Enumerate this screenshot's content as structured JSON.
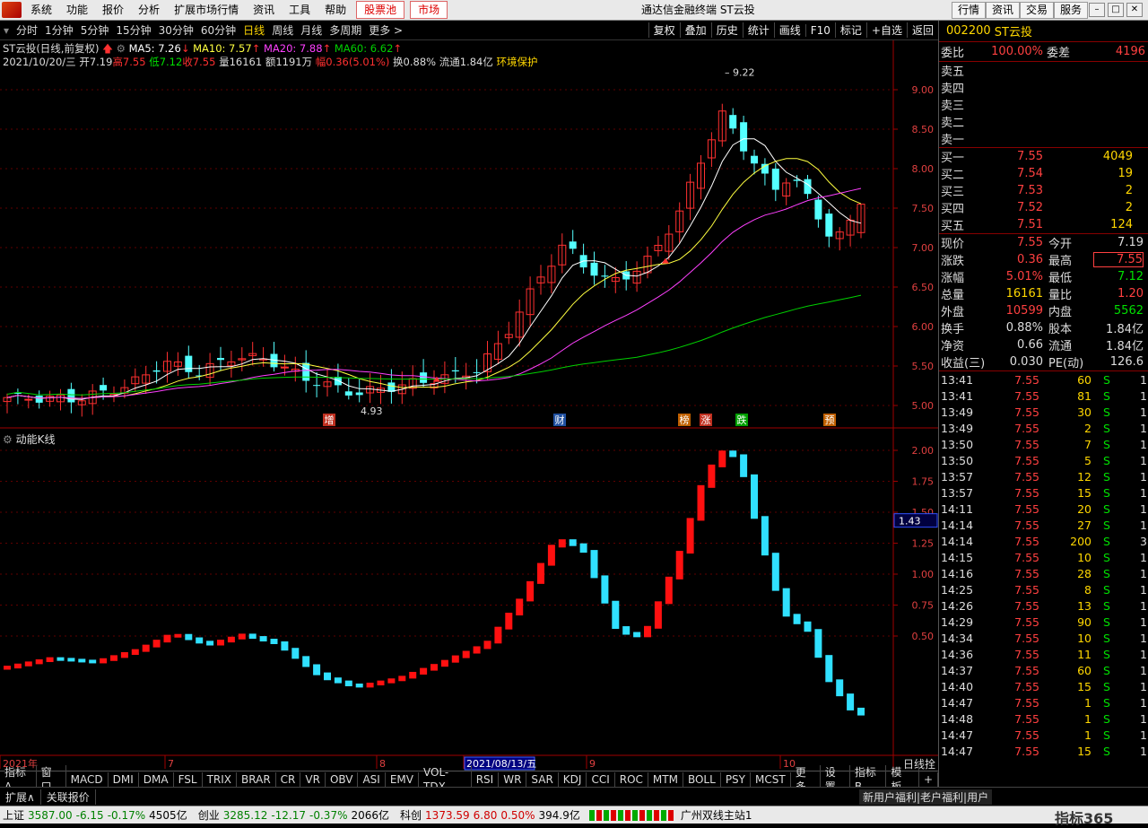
{
  "menubar": {
    "items": [
      "系统",
      "功能",
      "报价",
      "分析",
      "扩展市场行情",
      "资讯",
      "工具",
      "帮助"
    ],
    "red_items": [
      "股票池",
      "市场"
    ],
    "title": "通达信金融终端  ST云投",
    "right_buttons": [
      "行情",
      "资讯",
      "交易",
      "服务"
    ]
  },
  "periods": {
    "items": [
      "分时",
      "1分钟",
      "5分钟",
      "15分钟",
      "30分钟",
      "60分钟",
      "日线",
      "周线",
      "月线",
      "多周期",
      "更多 >"
    ],
    "selected": "日线"
  },
  "tools": [
    "复权",
    "叠加",
    "历史",
    "统计",
    "画线",
    "F10",
    "标记",
    "+自选",
    "返回"
  ],
  "chart": {
    "header": {
      "name": "ST云投(日线,前复权)",
      "ma5": "MA5: 7.26",
      "ma10": "MA10: 7.57",
      "ma20": "MA20: 7.88",
      "ma60": "MA60: 6.62"
    },
    "info": {
      "date": "2021/10/20/三",
      "open": "开7.19",
      "high": "高7.55",
      "low": "低7.12",
      "close": "收7.55",
      "vol": "量16161",
      "amt": "额1191万",
      "chg": "幅0.36(5.01%)",
      "turn": "换0.88%",
      "float": "流通1.84亿",
      "tag": "环境保护"
    },
    "price_ticks": [
      "9.00",
      "8.50",
      "8.00",
      "7.50",
      "7.00",
      "6.50",
      "6.00",
      "5.50",
      "5.00"
    ],
    "labels": {
      "high": "9.22",
      "low": "4.93"
    },
    "markers": [
      "增",
      "财",
      "榜",
      "涨",
      "跌",
      "预"
    ],
    "sub_title": "动能K线",
    "sub_ticks": [
      "2.00",
      "1.75",
      "1.50",
      "1.25",
      "1.00",
      "0.75",
      "0.50"
    ],
    "sub_current": "1.43",
    "x_labels": [
      "2021年",
      "7",
      "8",
      "2021/08/13/五",
      "9",
      "10"
    ],
    "corner": "日线拴"
  },
  "panel": {
    "code": "002200",
    "name": "ST云投",
    "weibi": {
      "label": "委比",
      "value": "100.00%",
      "label2": "委差",
      "value2": "4196"
    },
    "sell": [
      "卖五",
      "卖四",
      "卖三",
      "卖二",
      "卖一"
    ],
    "buy": [
      {
        "l": "买一",
        "p": "7.55",
        "v": "4049"
      },
      {
        "l": "买二",
        "p": "7.54",
        "v": "19"
      },
      {
        "l": "买三",
        "p": "7.53",
        "v": "2"
      },
      {
        "l": "买四",
        "p": "7.52",
        "v": "2"
      },
      {
        "l": "买五",
        "p": "7.51",
        "v": "124"
      }
    ],
    "stats": [
      {
        "a": "现价",
        "av": "7.55",
        "b": "今开",
        "bv": "7.19"
      },
      {
        "a": "涨跌",
        "av": "0.36",
        "b": "最高",
        "bv": "7.55"
      },
      {
        "a": "涨幅",
        "av": "5.01%",
        "b": "最低",
        "bv": "7.12"
      },
      {
        "a": "总量",
        "av": "16161",
        "b": "量比",
        "bv": "1.20"
      },
      {
        "a": "外盘",
        "av": "10599",
        "b": "内盘",
        "bv": "5562"
      },
      {
        "a": "换手",
        "av": "0.88%",
        "b": "股本",
        "bv": "1.84亿"
      },
      {
        "a": "净资",
        "av": "0.66",
        "b": "流通",
        "bv": "1.84亿"
      },
      {
        "a": "收益(三)",
        "av": "0.030",
        "b": "PE(动)",
        "bv": "126.6"
      }
    ],
    "ticks": [
      [
        "13:41",
        "7.55",
        "60",
        "S",
        "1"
      ],
      [
        "13:41",
        "7.55",
        "81",
        "S",
        "1"
      ],
      [
        "13:49",
        "7.55",
        "30",
        "S",
        "1"
      ],
      [
        "13:49",
        "7.55",
        "2",
        "S",
        "1"
      ],
      [
        "13:50",
        "7.55",
        "7",
        "S",
        "1"
      ],
      [
        "13:50",
        "7.55",
        "5",
        "S",
        "1"
      ],
      [
        "13:57",
        "7.55",
        "12",
        "S",
        "1"
      ],
      [
        "13:57",
        "7.55",
        "15",
        "S",
        "1"
      ],
      [
        "14:11",
        "7.55",
        "20",
        "S",
        "1"
      ],
      [
        "14:14",
        "7.55",
        "27",
        "S",
        "1"
      ],
      [
        "14:14",
        "7.55",
        "200",
        "S",
        "3"
      ],
      [
        "14:15",
        "7.55",
        "10",
        "S",
        "1"
      ],
      [
        "14:16",
        "7.55",
        "28",
        "S",
        "1"
      ],
      [
        "14:25",
        "7.55",
        "8",
        "S",
        "1"
      ],
      [
        "14:26",
        "7.55",
        "13",
        "S",
        "1"
      ],
      [
        "14:29",
        "7.55",
        "90",
        "S",
        "1"
      ],
      [
        "14:34",
        "7.55",
        "10",
        "S",
        "1"
      ],
      [
        "14:36",
        "7.55",
        "11",
        "S",
        "1"
      ],
      [
        "14:37",
        "7.55",
        "60",
        "S",
        "1"
      ],
      [
        "14:40",
        "7.55",
        "15",
        "S",
        "1"
      ],
      [
        "14:47",
        "7.55",
        "1",
        "S",
        "1"
      ],
      [
        "14:48",
        "7.55",
        "1",
        "S",
        "1"
      ],
      [
        "14:47",
        "7.55",
        "1",
        "S",
        "1"
      ],
      [
        "14:47",
        "7.55",
        "15",
        "S",
        "1"
      ]
    ]
  },
  "tabs": [
    "指标A",
    "窗口",
    "MACD",
    "DMI",
    "DMA",
    "FSL",
    "TRIX",
    "BRAR",
    "CR",
    "VR",
    "OBV",
    "ASI",
    "EMV",
    "VOL-TDX",
    "RSI",
    "WR",
    "SAR",
    "KDJ",
    "CCI",
    "ROC",
    "MTM",
    "BOLL",
    "PSY",
    "MCST",
    "更多",
    "设置"
  ],
  "tabs_right": [
    "指标B",
    "模 板",
    "+"
  ],
  "extbar": {
    "left": "扩展∧",
    "quote": "关联报价",
    "ticker": "新用户福利|老户福利|用户"
  },
  "status": {
    "sh": "上证",
    "sh_v": "3587.00",
    "sh_c": "-6.15",
    "sh_p": "-0.17%",
    "sh_a": "4505亿",
    "cy": "创业",
    "cy_v": "3285.12",
    "cy_c": "-12.17",
    "cy_p": "-0.37%",
    "cy_a": "2066亿",
    "kc": "科创",
    "kc_v": "1373.59",
    "kc_c": "6.80",
    "kc_p": "0.50%",
    "kc_a": "394.9亿",
    "site": "广州双线主站1",
    "brand": "指标365"
  },
  "colors": {
    "up": "#ff3030",
    "down": "#54ffff",
    "ma5": "#ffffff",
    "ma10": "#ffff40",
    "ma20": "#ff40ff",
    "ma60": "#00d000"
  }
}
